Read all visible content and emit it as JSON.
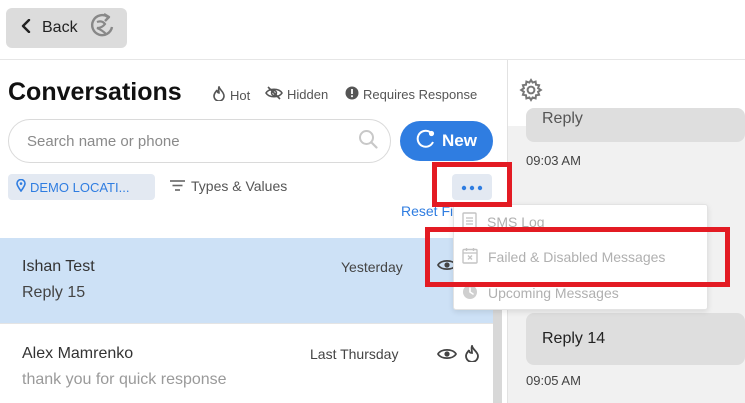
{
  "header": {
    "back_label": "Back"
  },
  "conversations": {
    "title": "Conversations",
    "legend": {
      "hot": "Hot",
      "hidden": "Hidden",
      "requires_response": "Requires Response"
    },
    "search_placeholder": "Search name or phone",
    "new_label": "New",
    "location_chip": "DEMO LOCATI...",
    "types_values": "Types & Values",
    "reset_filters": "Reset Fi",
    "rows": [
      {
        "name": "Ishan Test",
        "preview": "Reply 15",
        "when": "Yesterday"
      },
      {
        "name": "Alex Mamrenko",
        "preview": "thank you for quick response",
        "when": "Last Thursday"
      }
    ]
  },
  "more_menu": {
    "items": [
      {
        "label": "SMS Log",
        "icon": "document-icon"
      },
      {
        "label": "Failed & Disabled Messages",
        "icon": "calendar-x-icon"
      },
      {
        "label": "Upcoming Messages",
        "icon": "clock-icon"
      }
    ]
  },
  "thread": {
    "messages": [
      {
        "text": "Reply",
        "time": "09:03 AM"
      },
      {
        "text": "Reply 14",
        "time": "09:05 AM"
      }
    ]
  },
  "colors": {
    "accent": "#2f7de1",
    "selected_row": "#cde1f6",
    "highlight": "#e31b23"
  }
}
